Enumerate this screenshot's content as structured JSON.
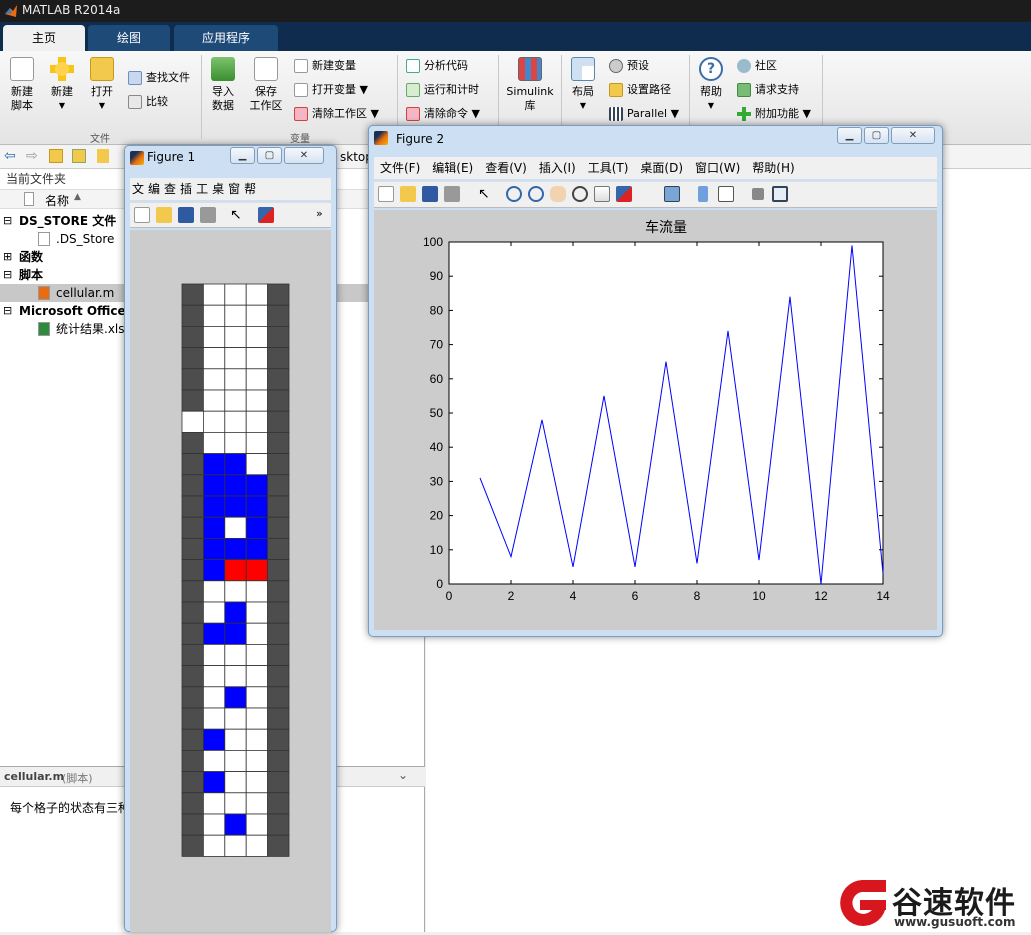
{
  "app": {
    "title": "MATLAB R2014a"
  },
  "tabs": [
    {
      "label": "主页",
      "active": true
    },
    {
      "label": "绘图",
      "active": false
    },
    {
      "label": "应用程序",
      "active": false
    }
  ],
  "ribbon": {
    "file_group": {
      "label": "文件",
      "new_script": "新建\n脚本",
      "new": "新建",
      "open": "打开",
      "find_files": "查找文件",
      "compare": "比较"
    },
    "var_group": {
      "label": "变量",
      "import": "导入\n数据",
      "save_ws": "保存\n工作区",
      "new_var": "新建变量",
      "open_var": "打开变量",
      "clear_ws": "清除工作区"
    },
    "code_group": {
      "analyze": "分析代码",
      "run_time": "运行和计时",
      "clear_cmd": "清除命令"
    },
    "simulink": "Simulink\n库",
    "env_group": {
      "layout": "布局",
      "prefs": "预设",
      "set_path": "设置路径",
      "parallel": "Parallel"
    },
    "res_group": {
      "help": "帮助",
      "community": "社区",
      "support": "请求支持",
      "addons": "附加功能"
    }
  },
  "addr": {
    "path_fragment": "sktop"
  },
  "current_folder": {
    "title": "当前文件夹",
    "col_name": "名称",
    "rows": [
      {
        "label": "DS_STORE 文件",
        "bold": true,
        "expander": "⊟",
        "indent": 0
      },
      {
        "label": ".DS_Store",
        "bold": false,
        "expander": "",
        "indent": 1
      },
      {
        "label": "函数",
        "bold": true,
        "expander": "⊞",
        "indent": 0
      },
      {
        "label": "脚本",
        "bold": true,
        "expander": "⊟",
        "indent": 0
      },
      {
        "label": "cellular.m",
        "bold": false,
        "expander": "",
        "indent": 1,
        "selected": true
      },
      {
        "label": "Microsoft Office",
        "bold": true,
        "expander": "⊟",
        "indent": 0
      },
      {
        "label": "统计结果.xls",
        "bold": false,
        "expander": "",
        "indent": 1
      }
    ]
  },
  "details": {
    "title": "cellular.m",
    "subtitle": "(脚本)",
    "text": "每个格子的状态有三种"
  },
  "figure1": {
    "title": "Figure 1",
    "menu": [
      "文",
      "编",
      "查",
      "插",
      "工",
      "桌",
      "窗",
      "帮"
    ],
    "grid": {
      "cols": 5,
      "rows": 27,
      "colors": {
        "0": "#ffffff",
        "1": "#0000ff",
        "2": "#ff0000",
        "3": "#4d4d4d"
      },
      "cells": [
        [
          3,
          0,
          0,
          0,
          3
        ],
        [
          3,
          0,
          0,
          0,
          3
        ],
        [
          3,
          0,
          0,
          0,
          3
        ],
        [
          3,
          0,
          0,
          0,
          3
        ],
        [
          3,
          0,
          0,
          0,
          3
        ],
        [
          3,
          0,
          0,
          0,
          3
        ],
        [
          0,
          0,
          0,
          0,
          3
        ],
        [
          3,
          0,
          0,
          0,
          3
        ],
        [
          3,
          1,
          1,
          0,
          3
        ],
        [
          3,
          1,
          1,
          1,
          3
        ],
        [
          3,
          1,
          1,
          1,
          3
        ],
        [
          3,
          1,
          0,
          1,
          3
        ],
        [
          3,
          1,
          1,
          1,
          3
        ],
        [
          3,
          1,
          2,
          2,
          3
        ],
        [
          3,
          0,
          0,
          0,
          3
        ],
        [
          3,
          0,
          1,
          0,
          3
        ],
        [
          3,
          1,
          1,
          0,
          3
        ],
        [
          3,
          0,
          0,
          0,
          3
        ],
        [
          3,
          0,
          0,
          0,
          3
        ],
        [
          3,
          0,
          1,
          0,
          3
        ],
        [
          3,
          0,
          0,
          0,
          3
        ],
        [
          3,
          1,
          0,
          0,
          3
        ],
        [
          3,
          0,
          0,
          0,
          3
        ],
        [
          3,
          1,
          0,
          0,
          3
        ],
        [
          3,
          0,
          0,
          0,
          3
        ],
        [
          3,
          0,
          1,
          0,
          3
        ],
        [
          3,
          0,
          0,
          0,
          3
        ]
      ]
    }
  },
  "figure2": {
    "title": "Figure 2",
    "menu": [
      "文件(F)",
      "编辑(E)",
      "查看(V)",
      "插入(I)",
      "工具(T)",
      "桌面(D)",
      "窗口(W)",
      "帮助(H)"
    ]
  },
  "chart_data": {
    "type": "line",
    "title": "车流量",
    "xlabel": "",
    "ylabel": "",
    "xlim": [
      0,
      14
    ],
    "ylim": [
      0,
      100
    ],
    "xticks": [
      0,
      2,
      4,
      6,
      8,
      10,
      12,
      14
    ],
    "yticks": [
      0,
      10,
      20,
      30,
      40,
      50,
      60,
      70,
      80,
      90,
      100
    ],
    "grid": false,
    "color": "#0000ff",
    "series": [
      {
        "x": [
          1,
          2,
          3,
          4,
          5,
          6,
          7,
          8,
          9,
          10,
          11,
          12,
          13,
          14
        ],
        "values": [
          31,
          8,
          48,
          5,
          55,
          5,
          65,
          6,
          74,
          7,
          84,
          0,
          99,
          3
        ]
      }
    ]
  },
  "watermark": {
    "brand": "谷速软件",
    "url": "www.gusuoft.com"
  }
}
